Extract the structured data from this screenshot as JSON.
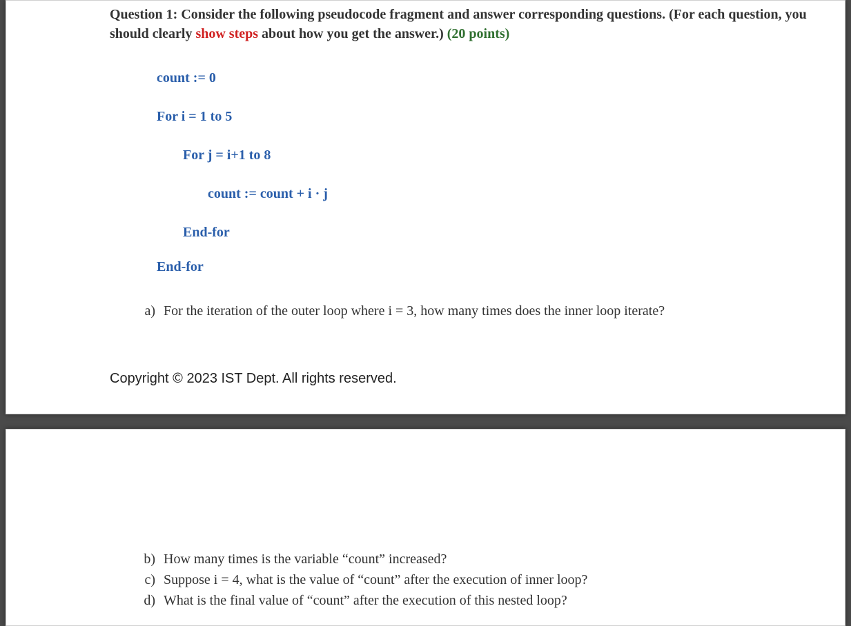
{
  "question": {
    "label": "Question 1:",
    "prompt_part1": "  Consider the following pseudocode fragment and answer corresponding questions. (For each question, you should clearly ",
    "prompt_highlight": "show steps",
    "prompt_part2": " about how you get the answer.) ",
    "points": "(20 points)"
  },
  "pseudocode": {
    "line1": "count := 0",
    "line2": "For i = 1 to 5",
    "line3": "For j = i+1 to 8",
    "line4": "count := count + i · j",
    "line5": "End-for",
    "line6": "End-for"
  },
  "subquestions": {
    "a_marker": "a)",
    "a_text": "For the iteration of the outer loop where i = 3, how many times does the inner loop iterate?",
    "b_marker": "b)",
    "b_text": "How many times is the variable “count” increased?",
    "c_marker": "c)",
    "c_text": "Suppose i = 4, what is the value of “count” after the execution of inner loop?",
    "d_marker": "d)",
    "d_text": "What is the final value of “count” after the execution of this nested loop?"
  },
  "footer": {
    "copyright": "Copyright © 2023 IST Dept. All rights reserved."
  }
}
